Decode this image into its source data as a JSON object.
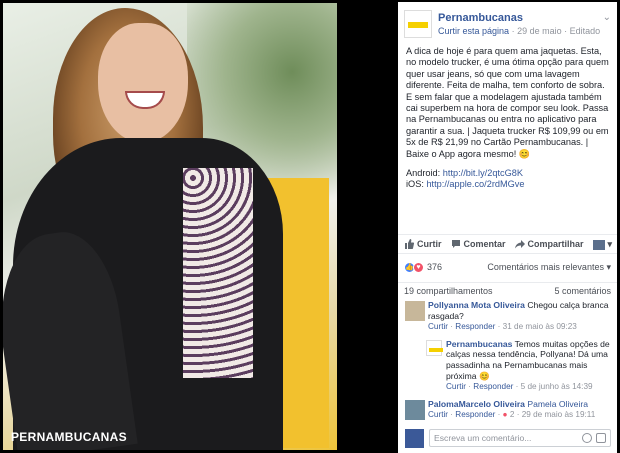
{
  "photo": {
    "brand": "PERNAMBUCANAS"
  },
  "post": {
    "page_name": "Pernambucanas",
    "curtir_pagina": "Curtir esta página",
    "date": "29 de maio",
    "edited": "Editado",
    "paragraphs": [
      "A dica de hoje é para quem ama jaquetas. Esta, no modelo trucker, é uma ótima opção para quem quer usar jeans, só que com uma lavagem diferente. Feita de malha, tem conforto de sobra. E sem falar que a modelagem ajustada também cai superbem na hora de compor seu look. Passa na Pernambucanas ou entra no aplicativo para garantir a sua. | Jaqueta trucker R$ 109,99 ou em 5x de R$ 21,99 no Cartão Pernambucanas. | Baixe o App agora mesmo! 😊"
    ],
    "android_label": "Android:",
    "android_link": "http://bit.ly/2qtcG8K",
    "ios_label": "iOS:",
    "ios_link": "http://apple.co/2rdMGve"
  },
  "actions": {
    "like": "Curtir",
    "comment": "Comentar",
    "share": "Compartilhar"
  },
  "reactions": {
    "count": "376",
    "sort": "Comentários mais relevantes"
  },
  "shares": {
    "shares": "19 compartilhamentos",
    "comments": "5 comentários"
  },
  "comments": [
    {
      "author": "Pollyanna Mota Oliveira",
      "text": "Chegou calça branca rasgada?",
      "like": "Curtir",
      "reply": "Responder",
      "time": "31 de maio às 09:23"
    },
    {
      "author": "Pernambucanas",
      "text": "Temos muitas opções de calças nessa tendência, Pollyana! Dá uma passadinha na Pernambucanas mais próxima 😊",
      "like": "Curtir",
      "reply": "Responder",
      "time": "5 de junho às 14:39"
    },
    {
      "author": "PalomaMarcelo Oliveira",
      "tag": "Pamela Oliveira",
      "like": "Curtir",
      "reply": "Responder",
      "reactions": "2",
      "time": "29 de maio às 19:11"
    }
  ],
  "compose": {
    "placeholder": "Escreva um comentário..."
  },
  "colors": {
    "link": "#365899",
    "brand_yellow": "#f5d000",
    "fb_blue": "#3b5998",
    "love": "#f25268",
    "like": "#4080ff"
  }
}
